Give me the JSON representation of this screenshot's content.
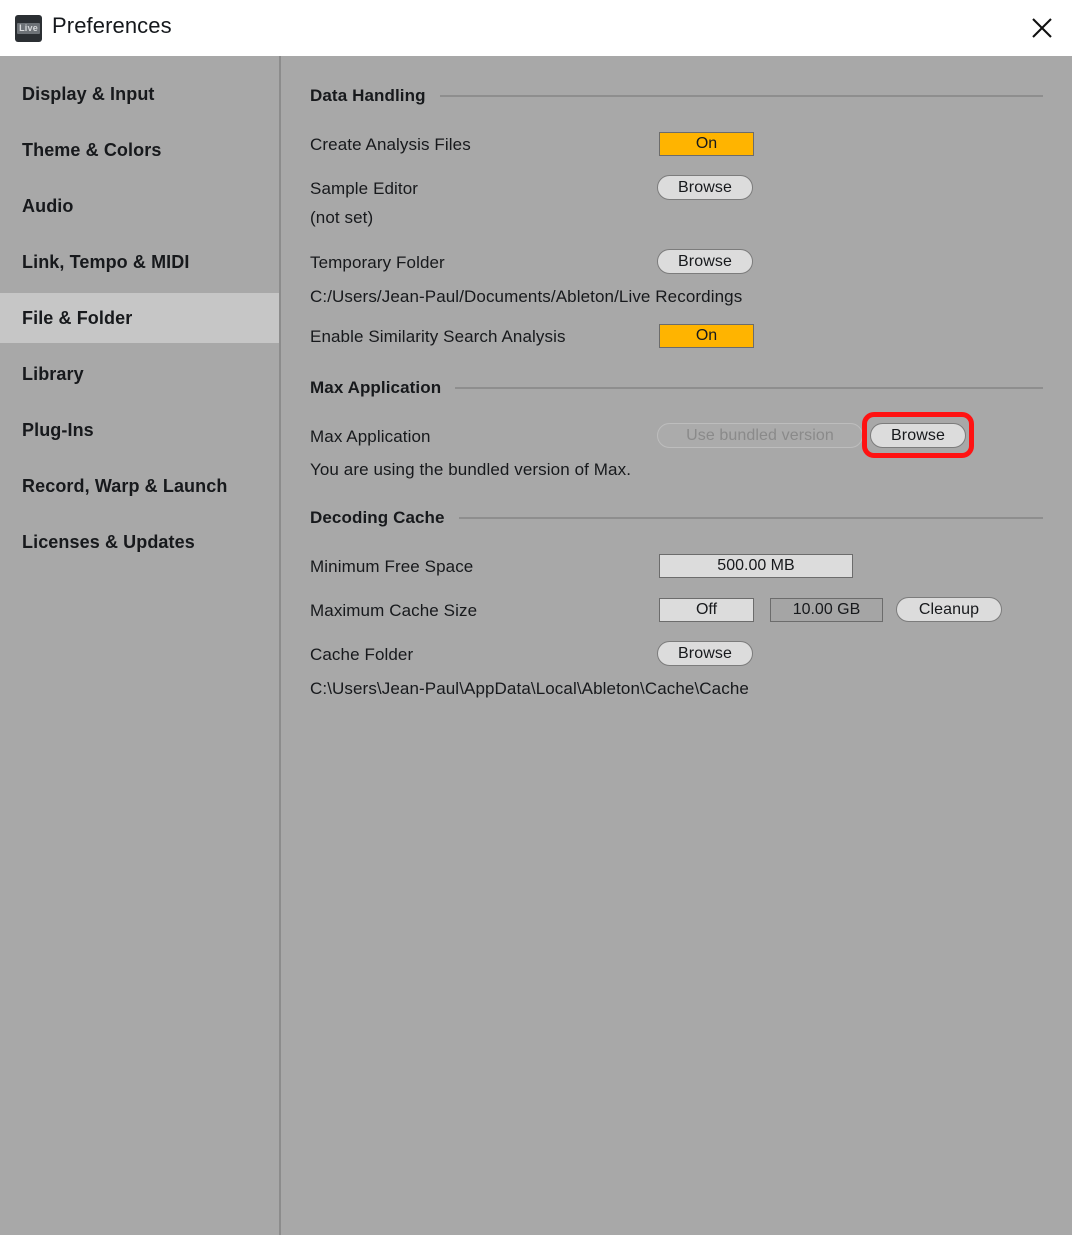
{
  "window": {
    "title": "Preferences",
    "logo_icon": "ableton-live-logo-icon",
    "logo_text": "Live",
    "close_icon": "close-icon"
  },
  "sidebar": {
    "items": [
      {
        "label": "Display & Input",
        "selected": false
      },
      {
        "label": "Theme & Colors",
        "selected": false
      },
      {
        "label": "Audio",
        "selected": false
      },
      {
        "label": "Link, Tempo & MIDI",
        "selected": false
      },
      {
        "label": "File & Folder",
        "selected": true
      },
      {
        "label": "Library",
        "selected": false
      },
      {
        "label": "Plug-Ins",
        "selected": false
      },
      {
        "label": "Record, Warp & Launch",
        "selected": false
      },
      {
        "label": "Licenses & Updates",
        "selected": false
      }
    ]
  },
  "main": {
    "sections": {
      "data_handling": {
        "title": "Data Handling",
        "create_analysis_files": {
          "label": "Create Analysis Files",
          "value": "On"
        },
        "sample_editor": {
          "label": "Sample Editor",
          "button": "Browse",
          "path": "(not set)"
        },
        "temporary_folder": {
          "label": "Temporary Folder",
          "button": "Browse",
          "path": "C:/Users/Jean-Paul/Documents/Ableton/Live Recordings"
        },
        "similarity_search": {
          "label": "Enable Similarity Search Analysis",
          "value": "On"
        }
      },
      "max_application": {
        "title": "Max Application",
        "row": {
          "label": "Max Application",
          "version_value": "Use bundled version",
          "button": "Browse"
        },
        "status": "You are using the bundled version of Max."
      },
      "decoding_cache": {
        "title": "Decoding Cache",
        "minimum_free_space": {
          "label": "Minimum Free Space",
          "value": "500.00 MB"
        },
        "maximum_cache_size": {
          "label": "Maximum Cache Size",
          "toggle": "Off",
          "value": "10.00 GB",
          "button": "Cleanup"
        },
        "cache_folder": {
          "label": "Cache Folder",
          "button": "Browse",
          "path": "C:\\Users\\Jean-Paul\\AppData\\Local\\Ableton\\Cache\\Cache"
        }
      }
    }
  },
  "colors": {
    "accent_on": "#ffb400",
    "highlight_ring": "#ff1212",
    "panel_bg": "#a8a8a8",
    "selected_nav": "#c6c6c6",
    "titlebar_bg": "#ffffff"
  }
}
